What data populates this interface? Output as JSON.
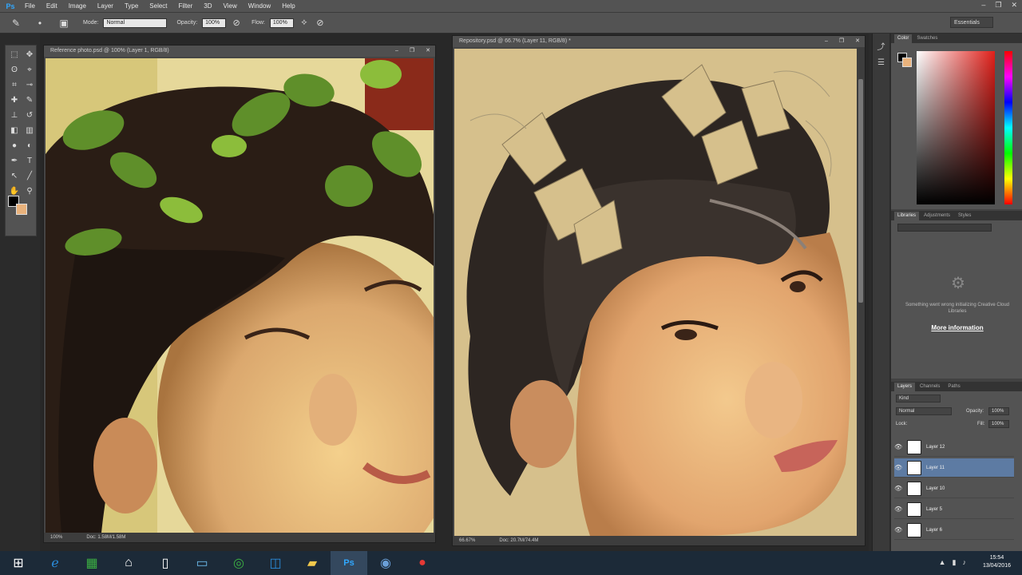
{
  "app": {
    "logo": "Ps"
  },
  "menu": [
    "File",
    "Edit",
    "Image",
    "Layer",
    "Type",
    "Select",
    "Filter",
    "3D",
    "View",
    "Window",
    "Help"
  ],
  "options": {
    "mode_label": "Mode:",
    "mode_value": "Normal",
    "opacity_label": "Opacity:",
    "opacity_value": "100%",
    "flow_label": "Flow:",
    "flow_value": "100%",
    "workspace": "Essentials"
  },
  "doc_left": {
    "title": "Reference photo.psd @ 100% (Layer 1, RGB/8)",
    "zoom": "100%",
    "doc_size": "Doc: 1.58M/1.58M"
  },
  "doc_right": {
    "title": "Repository.psd @ 66.7% (Layer 11, RGB/8) *",
    "zoom": "66.67%",
    "doc_size": "Doc: 20.7M/74.4M"
  },
  "color_panel": {
    "tabs": [
      "Color",
      "Swatches"
    ],
    "fg": "#000000",
    "bg": "#e9b27c"
  },
  "libraries_panel": {
    "tabs": [
      "Libraries",
      "Adjustments",
      "Styles"
    ],
    "message": "Something went wrong initializing Creative Cloud Libraries",
    "link": "More information"
  },
  "layers_panel": {
    "tabs": [
      "Layers",
      "Channels",
      "Paths"
    ],
    "kind": "Kind",
    "blend": "Normal",
    "opacity_label": "Opacity:",
    "opacity": "100%",
    "lock_label": "Lock:",
    "fill_label": "Fill:",
    "fill": "100%",
    "layers": [
      {
        "name": "Layer 12",
        "selected": false
      },
      {
        "name": "Layer 11",
        "selected": true
      },
      {
        "name": "Layer 10",
        "selected": false
      },
      {
        "name": "Layer 5",
        "selected": false
      },
      {
        "name": "Layer 6",
        "selected": false
      }
    ]
  },
  "taskbar": {
    "apps": [
      "windows-start",
      "internet-explorer",
      "store",
      "home",
      "file",
      "monitor",
      "media",
      "ie-blue",
      "folder",
      "photoshop",
      "network",
      "record"
    ],
    "time": "15:54",
    "date": "13/04/2016"
  }
}
